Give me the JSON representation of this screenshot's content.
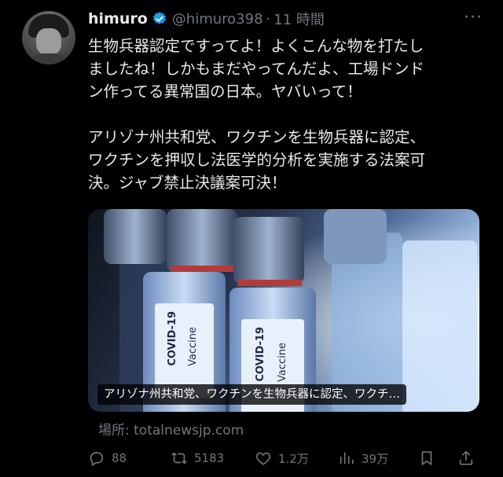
{
  "author": {
    "name": "himuro",
    "handle": "@himuro398",
    "separator": "·",
    "time": "11 時間",
    "verified_icon": "verified-badge-icon",
    "verified_color": "#1d9bf0"
  },
  "tweet": {
    "paragraph_1": "生物兵器認定ですってよ！よくこんな物を打たし\nましたね！しかもまだやってんだよ、工場ドンド\nン作ってる異常国の日本。ヤバいって！",
    "paragraph_2": "アリゾナ州共和党、ワクチンを生物兵器に認定、\nワクチンを押収し法医学的分析を実施する法案可\n決。ジャブ禁止決議案可決！"
  },
  "card": {
    "caption": "アリゾナ州共和党、ワクチンを生物兵器に認定、ワクチ…",
    "vial_label_1": "COVID-19",
    "vial_label_2": "COVID-19",
    "vial_sub_1": "Vaccine",
    "vial_sub_2": "Vaccine"
  },
  "source": {
    "text": "場所: totalnewsjp.com"
  },
  "actions": {
    "replies": "88",
    "retweets": "5183",
    "likes": "1.2万",
    "views": "39万"
  },
  "colors": {
    "background": "#000000",
    "text": "#e7e9ea",
    "muted": "#71767b",
    "accent": "#1d9bf0"
  }
}
